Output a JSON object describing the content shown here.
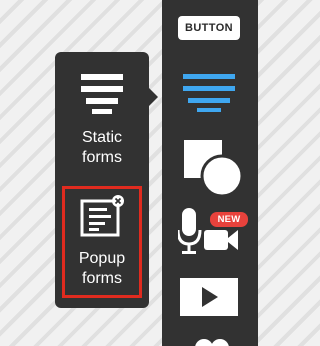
{
  "toolbar": {
    "button_label": "BUTTON",
    "new_badge": "NEW",
    "tools": [
      {
        "name": "text-block",
        "icon": "text-lines-icon",
        "active": true,
        "accent_color": "#3fa7f0"
      },
      {
        "name": "shapes",
        "icon": "shapes-icon"
      },
      {
        "name": "audio-video",
        "icon": "mic-video-icon"
      },
      {
        "name": "video",
        "icon": "play-icon"
      }
    ]
  },
  "popup_menu": {
    "items": [
      {
        "label": "Static\nforms",
        "icon": "static-form-icon",
        "selected": false
      },
      {
        "label": "Popup\nforms",
        "icon": "popup-form-icon",
        "selected": true,
        "highlight_color": "#e02b1f"
      }
    ]
  }
}
